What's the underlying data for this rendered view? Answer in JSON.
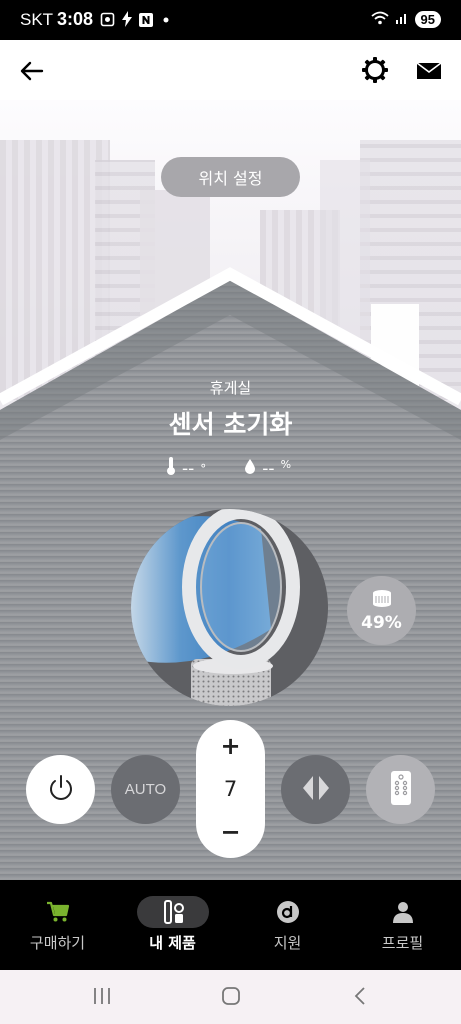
{
  "status_bar": {
    "carrier": "SKT",
    "time": "3:08",
    "battery": "95",
    "icons": [
      "screenshot-icon",
      "charging-icon",
      "naver-icon",
      "dot-icon",
      "wifi-icon",
      "signal-icon"
    ]
  },
  "app_bar": {
    "icons": [
      "back-arrow-icon",
      "settings-gear-icon",
      "mail-icon"
    ]
  },
  "scene": {
    "location_button": "위치 설정",
    "room_name": "휴게실",
    "device_status": "센서 초기화",
    "temperature": {
      "value": "--",
      "unit": "°"
    },
    "humidity": {
      "value": "--",
      "unit": "%"
    },
    "filter_life": "49%"
  },
  "controls": {
    "auto_label": "AUTO",
    "speed": {
      "plus": "+",
      "value": "7",
      "minus": "−"
    },
    "icons": [
      "power-icon",
      "oscillation-icon",
      "remote-icon",
      "filter-icon"
    ]
  },
  "bottom_nav": {
    "items": [
      {
        "label": "구매하기",
        "icon": "cart-icon",
        "active": false
      },
      {
        "label": "내 제품",
        "icon": "my-products-icon",
        "active": true
      },
      {
        "label": "지원",
        "icon": "support-icon",
        "active": false
      },
      {
        "label": "프로필",
        "icon": "profile-icon",
        "active": false
      }
    ]
  },
  "colors": {
    "cart_accent": "#7ab32e",
    "dark_control": "#6b6d72",
    "house_wall": "#8f9296"
  }
}
